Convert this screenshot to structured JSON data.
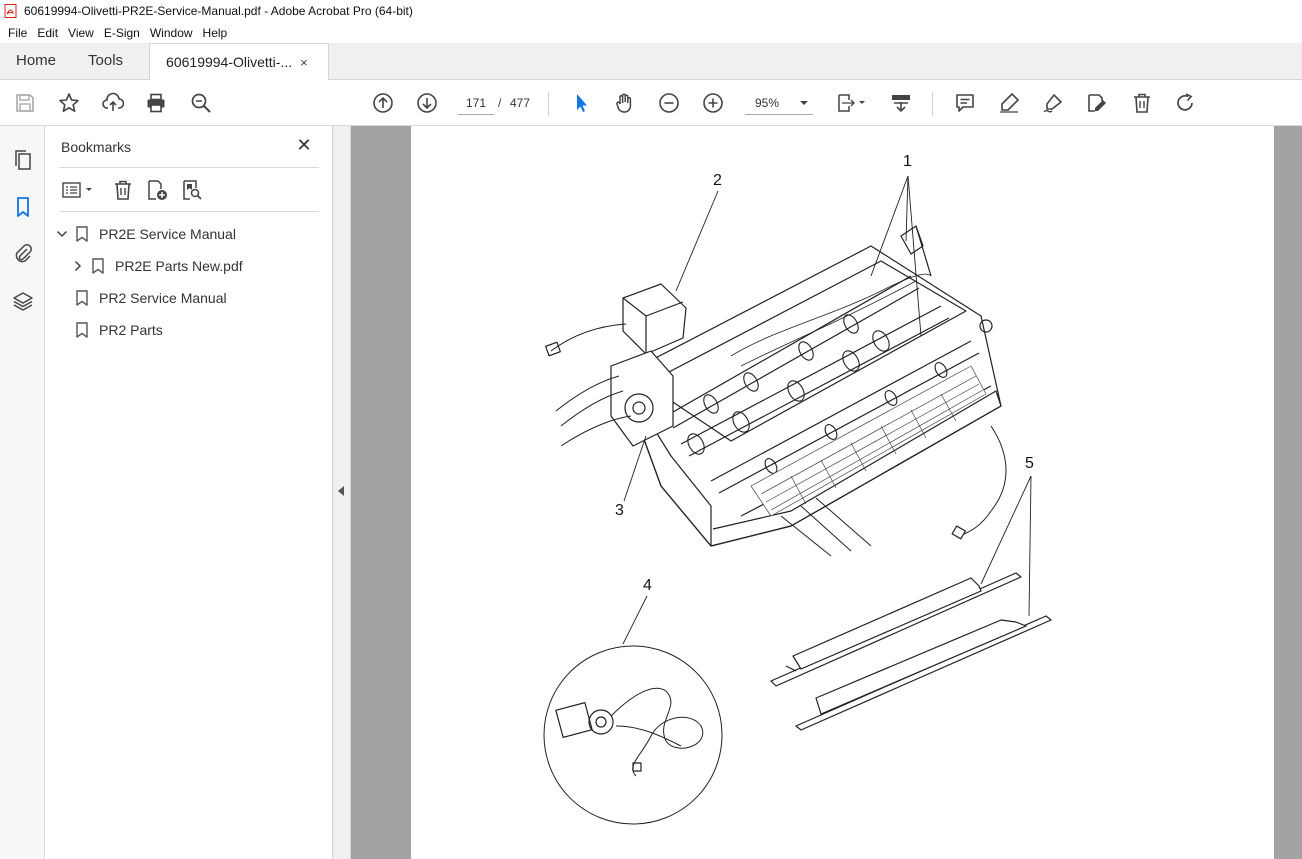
{
  "window": {
    "title": "60619994-Olivetti-PR2E-Service-Manual.pdf - Adobe Acrobat Pro (64-bit)",
    "accent": "#d4251c"
  },
  "menu": [
    "File",
    "Edit",
    "View",
    "E-Sign",
    "Window",
    "Help"
  ],
  "tabs": {
    "home": "Home",
    "tools": "Tools",
    "document": "60619994-Olivetti-...",
    "close": "×"
  },
  "toolbar": {
    "icons": [
      "save-icon",
      "star-icon",
      "upload-icon",
      "print-icon",
      "zoom-search-icon",
      "page-up-icon",
      "page-down-icon",
      "select-arrow-icon",
      "hand-icon",
      "zoom-out-icon",
      "zoom-in-icon",
      "page-fit-icon",
      "scroll-mode-icon",
      "comment-icon",
      "highlight-icon",
      "sign-icon",
      "edit-icon",
      "delete-icon",
      "redo-icon"
    ],
    "current_page": "171",
    "page_sep": "/",
    "total_pages": "477",
    "zoom": "95%",
    "select_color": "#1473e6"
  },
  "bookmarks": {
    "header": "Bookmarks",
    "close": "✕",
    "items": [
      {
        "label": "PR2E Service Manual",
        "expanded": true,
        "level": 0
      },
      {
        "label": "PR2E Parts New.pdf",
        "expanded": false,
        "level": 1
      },
      {
        "label": "PR2 Service Manual",
        "level": 0
      },
      {
        "label": "PR2 Parts",
        "level": 0
      }
    ]
  },
  "document": {
    "callouts": [
      "1",
      "2",
      "3",
      "4",
      "5"
    ]
  }
}
